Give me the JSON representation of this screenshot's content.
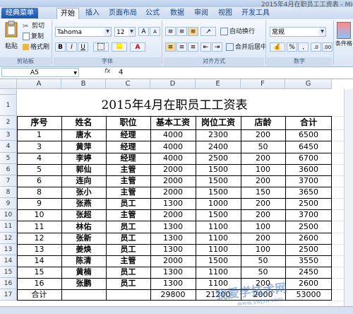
{
  "window": {
    "title": "2015年4月在职员工工资表 - Microsoft"
  },
  "tabs": [
    "经典菜单",
    "开始",
    "插入",
    "页面布局",
    "公式",
    "数据",
    "审阅",
    "视图",
    "开发工具"
  ],
  "ribbon": {
    "paste": "粘贴",
    "cut": "剪切",
    "copy": "复制",
    "format_painter": "格式刷",
    "font_name": "Tahoma",
    "font_size": "12",
    "bold": "B",
    "italic": "I",
    "underline": "U",
    "grow_font": "A",
    "shrink_font": "A",
    "wrap_text": "自动换行",
    "merge_center": "合并后居中",
    "number_format": "常规",
    "percent": "%",
    "comma": ",",
    "conditional_format": "条件格",
    "groups": {
      "clipboard": "剪贴板",
      "font": "字体",
      "alignment": "对齐方式",
      "number": "数字"
    }
  },
  "formula_bar": {
    "name_box": "A5",
    "fx": "fx",
    "value": "4"
  },
  "columns": [
    "A",
    "B",
    "C",
    "D",
    "E",
    "F",
    "G"
  ],
  "rows": [
    "1",
    "2",
    "3",
    "4",
    "5",
    "6",
    "7",
    "8",
    "9",
    "10",
    "11",
    "12",
    "13",
    "14",
    "15",
    "16",
    "17"
  ],
  "sheet": {
    "title": "2015年4月在职员工工资表",
    "headers": [
      "序号",
      "姓名",
      "职位",
      "基本工资",
      "岗位工资",
      "店龄",
      "合计"
    ],
    "data": [
      [
        "1",
        "唐水",
        "经理",
        "4000",
        "2300",
        "200",
        "6500"
      ],
      [
        "3",
        "黄萍",
        "经理",
        "4000",
        "2400",
        "50",
        "6450"
      ],
      [
        "4",
        "李婷",
        "经理",
        "4000",
        "2500",
        "200",
        "6700"
      ],
      [
        "5",
        "郭仙",
        "主管",
        "2000",
        "1500",
        "100",
        "3600"
      ],
      [
        "6",
        "连向",
        "主管",
        "2000",
        "1500",
        "200",
        "3700"
      ],
      [
        "8",
        "张小",
        "主管",
        "2000",
        "1500",
        "150",
        "3650"
      ],
      [
        "9",
        "张燕",
        "员工",
        "1300",
        "1000",
        "200",
        "2500"
      ],
      [
        "10",
        "张超",
        "主管",
        "2000",
        "1500",
        "200",
        "3700"
      ],
      [
        "11",
        "林佑",
        "员工",
        "1300",
        "1100",
        "100",
        "2500"
      ],
      [
        "12",
        "张新",
        "员工",
        "1300",
        "1100",
        "200",
        "2600"
      ],
      [
        "13",
        "姜焕",
        "员工",
        "1300",
        "1100",
        "100",
        "2500"
      ],
      [
        "14",
        "陈清",
        "主管",
        "2000",
        "1500",
        "50",
        "3550"
      ],
      [
        "15",
        "黄楠",
        "员工",
        "1300",
        "1100",
        "50",
        "2450"
      ],
      [
        "16",
        "张鹏",
        "员工",
        "1300",
        "1100",
        "200",
        "2600"
      ]
    ],
    "total": [
      "合计",
      "",
      "",
      "29800",
      "21200",
      "2000",
      "53000"
    ]
  },
  "watermark": {
    "text": "我爱学技术网",
    "url": "www.5wjsw.com"
  }
}
